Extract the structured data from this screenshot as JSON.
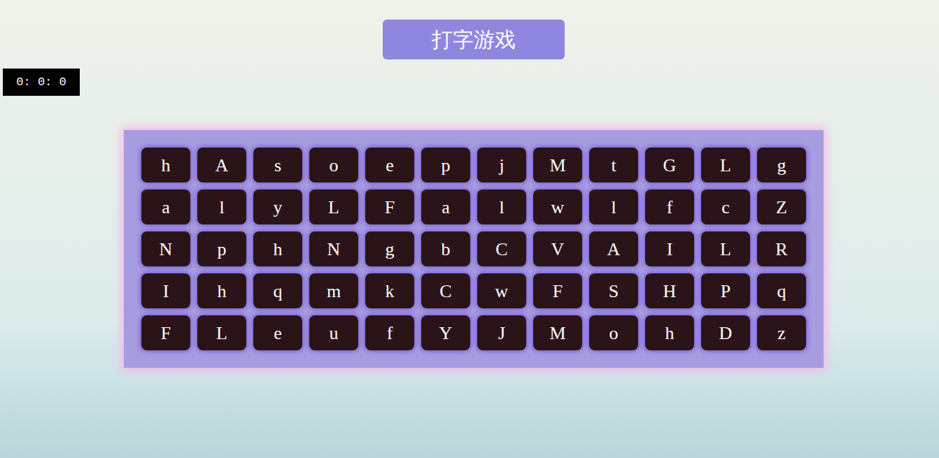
{
  "title": "打字游戏",
  "timer": "0: 0: 0",
  "keys": [
    [
      "h",
      "A",
      "s",
      "o",
      "e",
      "p",
      "j",
      "M",
      "t",
      "G",
      "L",
      "g"
    ],
    [
      "a",
      "l",
      "y",
      "L",
      "F",
      "a",
      "l",
      "w",
      "l",
      "f",
      "c",
      "Z"
    ],
    [
      "N",
      "p",
      "h",
      "N",
      "g",
      "b",
      "C",
      "V",
      "A",
      "I",
      "L",
      "R"
    ],
    [
      "I",
      "h",
      "q",
      "m",
      "k",
      "C",
      "w",
      "F",
      "S",
      "H",
      "P",
      "q"
    ],
    [
      "F",
      "L",
      "e",
      "u",
      "f",
      "Y",
      "J",
      "M",
      "o",
      "h",
      "D",
      "z"
    ]
  ]
}
